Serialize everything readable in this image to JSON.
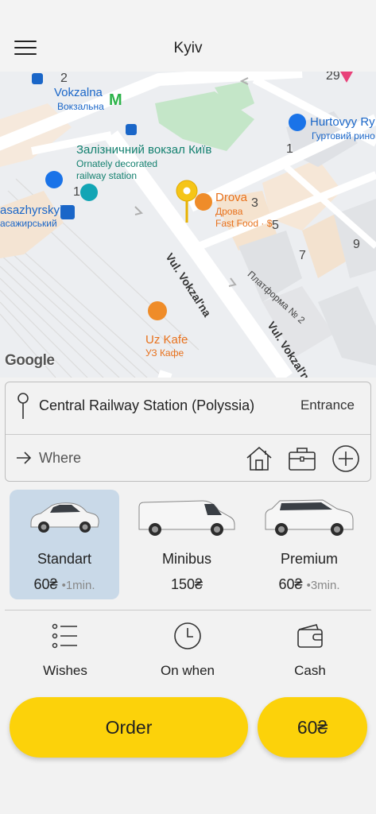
{
  "header": {
    "city": "Kyiv"
  },
  "map": {
    "labels": {
      "vokzalna_en": "Vokzalna",
      "vokzalna_ua": "Вокзальна",
      "station_ua": "Залізничний вокзал Київ",
      "station_desc1": "Ornately decorated",
      "station_desc2": "railway station",
      "pasazhyrskyi_en": "asazhyrskyi",
      "pasazhyrskyi_ua": "асажирський",
      "drova_en": "Drova",
      "drova_ua": "Дрова",
      "drova_cat": "Fast Food · $",
      "hurtovyy_en": "Hurtovyy Ry",
      "hurtovyy_ua": "Гуртовий рино",
      "uzkafe_en": "Uz Kafe",
      "uzkafe_ua": "УЗ Кафе",
      "road1": "Vul. Vokzal'na",
      "road2": "Vul. Vokzal'na",
      "platform": "Платформа № 2",
      "num_2": "2",
      "num_29": "29",
      "num_1a": "1",
      "num_1b": "1",
      "num_3": "3",
      "num_5": "5",
      "num_7": "7",
      "num_9": "9"
    },
    "google": "Google",
    "metro_letter": "M",
    "metro_color": "#2cb34a",
    "pin_color": "#f5c518"
  },
  "route": {
    "from": "Central Railway Station (Polyssia)",
    "entrance": "Entrance",
    "to_placeholder": "Where",
    "to_value": ""
  },
  "tariffs": [
    {
      "name": "Standart",
      "price": "60₴",
      "eta": "•1min.",
      "selected": true
    },
    {
      "name": "Minibus",
      "price": "150₴",
      "eta": "",
      "selected": false
    },
    {
      "name": "Premium",
      "price": "60₴",
      "eta": "•3min.",
      "selected": false
    }
  ],
  "options": [
    {
      "label": "Wishes",
      "icon": "list-icon"
    },
    {
      "label": "On when",
      "icon": "clock-icon"
    },
    {
      "label": "Cash",
      "icon": "wallet-icon"
    }
  ],
  "order": {
    "label": "Order",
    "price": "60₴"
  },
  "colors": {
    "accent": "#fcd20a",
    "selected_tariff": "#c9d9e8"
  }
}
